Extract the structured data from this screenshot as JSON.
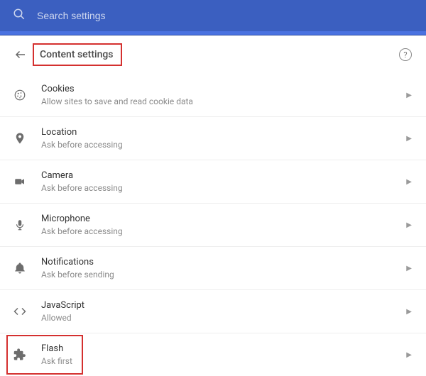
{
  "search": {
    "placeholder": "Search settings"
  },
  "header": {
    "title": "Content settings"
  },
  "items": [
    {
      "icon": "cookie",
      "title": "Cookies",
      "sub": "Allow sites to save and read cookie data"
    },
    {
      "icon": "location",
      "title": "Location",
      "sub": "Ask before accessing"
    },
    {
      "icon": "camera",
      "title": "Camera",
      "sub": "Ask before accessing"
    },
    {
      "icon": "microphone",
      "title": "Microphone",
      "sub": "Ask before accessing"
    },
    {
      "icon": "notifications",
      "title": "Notifications",
      "sub": "Ask before sending"
    },
    {
      "icon": "javascript",
      "title": "JavaScript",
      "sub": "Allowed"
    },
    {
      "icon": "flash",
      "title": "Flash",
      "sub": "Ask first"
    }
  ]
}
